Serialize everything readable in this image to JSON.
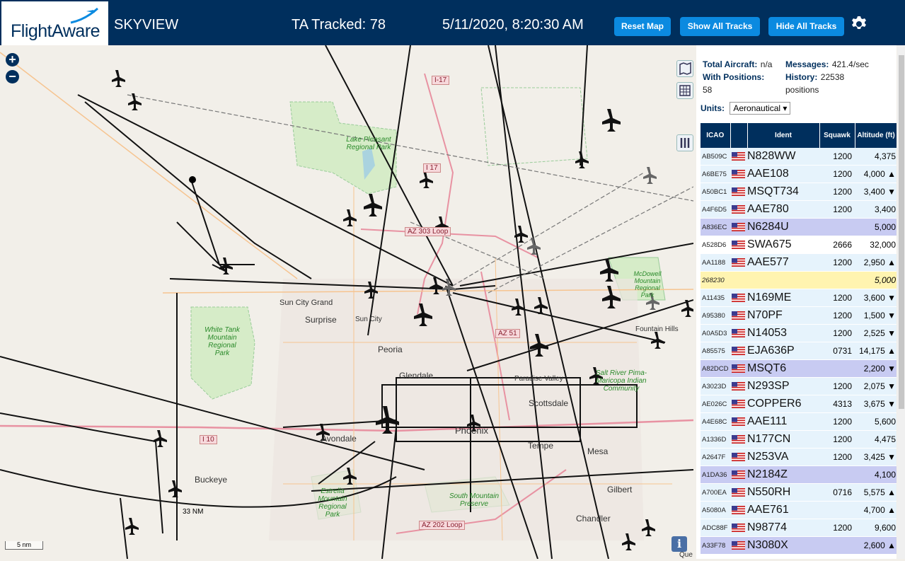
{
  "header": {
    "logo_text": "FlightAware",
    "site_name": "SKYVIEW",
    "tracked": "TA Tracked: 78",
    "datetime": "5/11/2020, 8:20:30 AM",
    "buttons": {
      "reset_map": "Reset Map",
      "show_all": "Show All Tracks",
      "hide_all": "Hide All Tracks"
    }
  },
  "map": {
    "zoom_in": "+",
    "zoom_out": "−",
    "scale": "5 nm",
    "range_label": "33 NM",
    "info": "i",
    "labels": [
      "Sun City Grand",
      "Surprise",
      "Sun City",
      "Peoria",
      "Glendale",
      "Paradise Valley",
      "Scottsdale",
      "Phoenix",
      "Tempe",
      "Mesa",
      "Avondale",
      "Buckeye",
      "Gilbert",
      "Chandler",
      "Fountain Hills",
      "Que"
    ],
    "park_labels": [
      "Lake Pleasant Regional Park",
      "White Tank Mountain Regional Park",
      "McDowell Mountain Regional Park",
      "Salt River Pima-Maricopa Indian Community",
      "Estrella Mountain Regional Park",
      "South Mountain Preserve"
    ],
    "road_shields": [
      "I-17",
      "I 17",
      "AZ 303 Loop",
      "AZ 51",
      "I 10",
      "AZ 202 Loop"
    ]
  },
  "stats": {
    "total_aircraft_label": "Total Aircraft:",
    "total_aircraft": "n/a",
    "messages_label": "Messages:",
    "messages": "421.4/sec",
    "with_positions_label": "With Positions:",
    "with_positions": "58",
    "history_label": "History:",
    "history": "22538 positions"
  },
  "units": {
    "label": "Units:",
    "value": "Aeronautical"
  },
  "table": {
    "columns": [
      "ICAO",
      "",
      "Ident",
      "Squawk",
      "Altitude (ft)"
    ],
    "rows": [
      {
        "icao": "AB509C",
        "flag": true,
        "ident": "N828WW",
        "squawk": "1200",
        "alt": "4,375",
        "style": "a"
      },
      {
        "icao": "A6BE75",
        "flag": true,
        "ident": "AAE108",
        "squawk": "1200",
        "alt": "4,000 ▲",
        "style": "a"
      },
      {
        "icao": "A50BC1",
        "flag": true,
        "ident": "MSQT734",
        "squawk": "1200",
        "alt": "3,400 ▼",
        "style": "a"
      },
      {
        "icao": "A4F6D5",
        "flag": true,
        "ident": "AAE780",
        "squawk": "1200",
        "alt": "3,400",
        "style": "a"
      },
      {
        "icao": "A836EC",
        "flag": true,
        "ident": "N6284U",
        "squawk": "",
        "alt": "5,000",
        "style": "m"
      },
      {
        "icao": "A528D6",
        "flag": true,
        "ident": "SWA675",
        "squawk": "2666",
        "alt": "32,000",
        "style": "w"
      },
      {
        "icao": "AA1188",
        "flag": true,
        "ident": "AAE577",
        "squawk": "1200",
        "alt": "2,950 ▲",
        "style": "a"
      },
      {
        "icao": "268230",
        "flag": false,
        "ident": "",
        "squawk": "",
        "alt": "5,000",
        "style": "y"
      },
      {
        "icao": "A11435",
        "flag": true,
        "ident": "N169ME",
        "squawk": "1200",
        "alt": "3,600 ▼",
        "style": "a"
      },
      {
        "icao": "A95380",
        "flag": true,
        "ident": "N70PF",
        "squawk": "1200",
        "alt": "1,500 ▼",
        "style": "a"
      },
      {
        "icao": "A0A5D3",
        "flag": true,
        "ident": "N14053",
        "squawk": "1200",
        "alt": "2,525 ▼",
        "style": "a"
      },
      {
        "icao": "A85575",
        "flag": true,
        "ident": "EJA636P",
        "squawk": "0731",
        "alt": "14,175 ▲",
        "style": "a"
      },
      {
        "icao": "A82DCD",
        "flag": true,
        "ident": "MSQT6",
        "squawk": "",
        "alt": "2,200 ▼",
        "style": "m"
      },
      {
        "icao": "A3023D",
        "flag": true,
        "ident": "N293SP",
        "squawk": "1200",
        "alt": "2,075 ▼",
        "style": "a"
      },
      {
        "icao": "AE026C",
        "flag": true,
        "ident": "COPPER6",
        "squawk": "4313",
        "alt": "3,675 ▼",
        "style": "a"
      },
      {
        "icao": "A4E68C",
        "flag": true,
        "ident": "AAE111",
        "squawk": "1200",
        "alt": "5,600",
        "style": "a"
      },
      {
        "icao": "A1336D",
        "flag": true,
        "ident": "N177CN",
        "squawk": "1200",
        "alt": "4,475",
        "style": "a"
      },
      {
        "icao": "A2647F",
        "flag": true,
        "ident": "N253VA",
        "squawk": "1200",
        "alt": "3,425 ▼",
        "style": "a"
      },
      {
        "icao": "A1DA36",
        "flag": true,
        "ident": "N2184Z",
        "squawk": "",
        "alt": "4,100",
        "style": "m"
      },
      {
        "icao": "A700EA",
        "flag": true,
        "ident": "N550RH",
        "squawk": "0716",
        "alt": "5,575 ▲",
        "style": "a"
      },
      {
        "icao": "A5080A",
        "flag": true,
        "ident": "AAE761",
        "squawk": "",
        "alt": "4,700 ▲",
        "style": "a"
      },
      {
        "icao": "ADC88F",
        "flag": true,
        "ident": "N98774",
        "squawk": "1200",
        "alt": "9,600",
        "style": "a"
      },
      {
        "icao": "A33F78",
        "flag": true,
        "ident": "N3080X",
        "squawk": "",
        "alt": "2,600 ▲",
        "style": "m"
      }
    ]
  },
  "colors": {
    "header_bg": "#002f5d",
    "button_bg": "#0b8ae0",
    "row_light": "#e6f3fc",
    "row_mlat": "#c8cbf2",
    "row_other": "#fff4b0"
  }
}
